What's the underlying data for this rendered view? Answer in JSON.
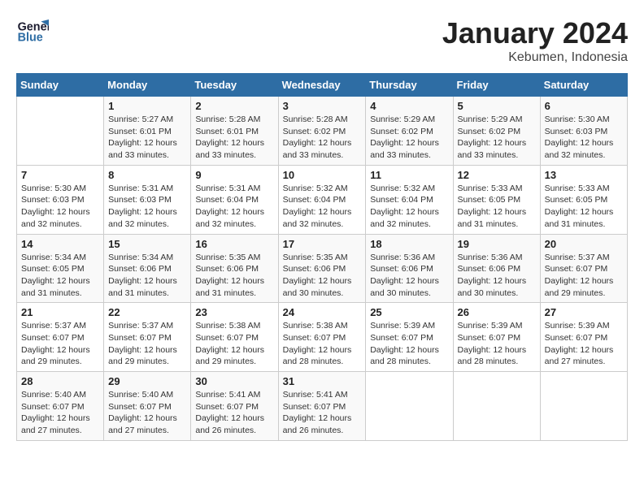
{
  "header": {
    "logo_line1": "General",
    "logo_line2": "Blue",
    "month": "January 2024",
    "location": "Kebumen, Indonesia"
  },
  "weekdays": [
    "Sunday",
    "Monday",
    "Tuesday",
    "Wednesday",
    "Thursday",
    "Friday",
    "Saturday"
  ],
  "weeks": [
    [
      {
        "day": "",
        "info": ""
      },
      {
        "day": "1",
        "info": "Sunrise: 5:27 AM\nSunset: 6:01 PM\nDaylight: 12 hours\nand 33 minutes."
      },
      {
        "day": "2",
        "info": "Sunrise: 5:28 AM\nSunset: 6:01 PM\nDaylight: 12 hours\nand 33 minutes."
      },
      {
        "day": "3",
        "info": "Sunrise: 5:28 AM\nSunset: 6:02 PM\nDaylight: 12 hours\nand 33 minutes."
      },
      {
        "day": "4",
        "info": "Sunrise: 5:29 AM\nSunset: 6:02 PM\nDaylight: 12 hours\nand 33 minutes."
      },
      {
        "day": "5",
        "info": "Sunrise: 5:29 AM\nSunset: 6:02 PM\nDaylight: 12 hours\nand 33 minutes."
      },
      {
        "day": "6",
        "info": "Sunrise: 5:30 AM\nSunset: 6:03 PM\nDaylight: 12 hours\nand 32 minutes."
      }
    ],
    [
      {
        "day": "7",
        "info": "Sunrise: 5:30 AM\nSunset: 6:03 PM\nDaylight: 12 hours\nand 32 minutes."
      },
      {
        "day": "8",
        "info": "Sunrise: 5:31 AM\nSunset: 6:03 PM\nDaylight: 12 hours\nand 32 minutes."
      },
      {
        "day": "9",
        "info": "Sunrise: 5:31 AM\nSunset: 6:04 PM\nDaylight: 12 hours\nand 32 minutes."
      },
      {
        "day": "10",
        "info": "Sunrise: 5:32 AM\nSunset: 6:04 PM\nDaylight: 12 hours\nand 32 minutes."
      },
      {
        "day": "11",
        "info": "Sunrise: 5:32 AM\nSunset: 6:04 PM\nDaylight: 12 hours\nand 32 minutes."
      },
      {
        "day": "12",
        "info": "Sunrise: 5:33 AM\nSunset: 6:05 PM\nDaylight: 12 hours\nand 31 minutes."
      },
      {
        "day": "13",
        "info": "Sunrise: 5:33 AM\nSunset: 6:05 PM\nDaylight: 12 hours\nand 31 minutes."
      }
    ],
    [
      {
        "day": "14",
        "info": "Sunrise: 5:34 AM\nSunset: 6:05 PM\nDaylight: 12 hours\nand 31 minutes."
      },
      {
        "day": "15",
        "info": "Sunrise: 5:34 AM\nSunset: 6:06 PM\nDaylight: 12 hours\nand 31 minutes."
      },
      {
        "day": "16",
        "info": "Sunrise: 5:35 AM\nSunset: 6:06 PM\nDaylight: 12 hours\nand 31 minutes."
      },
      {
        "day": "17",
        "info": "Sunrise: 5:35 AM\nSunset: 6:06 PM\nDaylight: 12 hours\nand 30 minutes."
      },
      {
        "day": "18",
        "info": "Sunrise: 5:36 AM\nSunset: 6:06 PM\nDaylight: 12 hours\nand 30 minutes."
      },
      {
        "day": "19",
        "info": "Sunrise: 5:36 AM\nSunset: 6:06 PM\nDaylight: 12 hours\nand 30 minutes."
      },
      {
        "day": "20",
        "info": "Sunrise: 5:37 AM\nSunset: 6:07 PM\nDaylight: 12 hours\nand 29 minutes."
      }
    ],
    [
      {
        "day": "21",
        "info": "Sunrise: 5:37 AM\nSunset: 6:07 PM\nDaylight: 12 hours\nand 29 minutes."
      },
      {
        "day": "22",
        "info": "Sunrise: 5:37 AM\nSunset: 6:07 PM\nDaylight: 12 hours\nand 29 minutes."
      },
      {
        "day": "23",
        "info": "Sunrise: 5:38 AM\nSunset: 6:07 PM\nDaylight: 12 hours\nand 29 minutes."
      },
      {
        "day": "24",
        "info": "Sunrise: 5:38 AM\nSunset: 6:07 PM\nDaylight: 12 hours\nand 28 minutes."
      },
      {
        "day": "25",
        "info": "Sunrise: 5:39 AM\nSunset: 6:07 PM\nDaylight: 12 hours\nand 28 minutes."
      },
      {
        "day": "26",
        "info": "Sunrise: 5:39 AM\nSunset: 6:07 PM\nDaylight: 12 hours\nand 28 minutes."
      },
      {
        "day": "27",
        "info": "Sunrise: 5:39 AM\nSunset: 6:07 PM\nDaylight: 12 hours\nand 27 minutes."
      }
    ],
    [
      {
        "day": "28",
        "info": "Sunrise: 5:40 AM\nSunset: 6:07 PM\nDaylight: 12 hours\nand 27 minutes."
      },
      {
        "day": "29",
        "info": "Sunrise: 5:40 AM\nSunset: 6:07 PM\nDaylight: 12 hours\nand 27 minutes."
      },
      {
        "day": "30",
        "info": "Sunrise: 5:41 AM\nSunset: 6:07 PM\nDaylight: 12 hours\nand 26 minutes."
      },
      {
        "day": "31",
        "info": "Sunrise: 5:41 AM\nSunset: 6:07 PM\nDaylight: 12 hours\nand 26 minutes."
      },
      {
        "day": "",
        "info": ""
      },
      {
        "day": "",
        "info": ""
      },
      {
        "day": "",
        "info": ""
      }
    ]
  ]
}
